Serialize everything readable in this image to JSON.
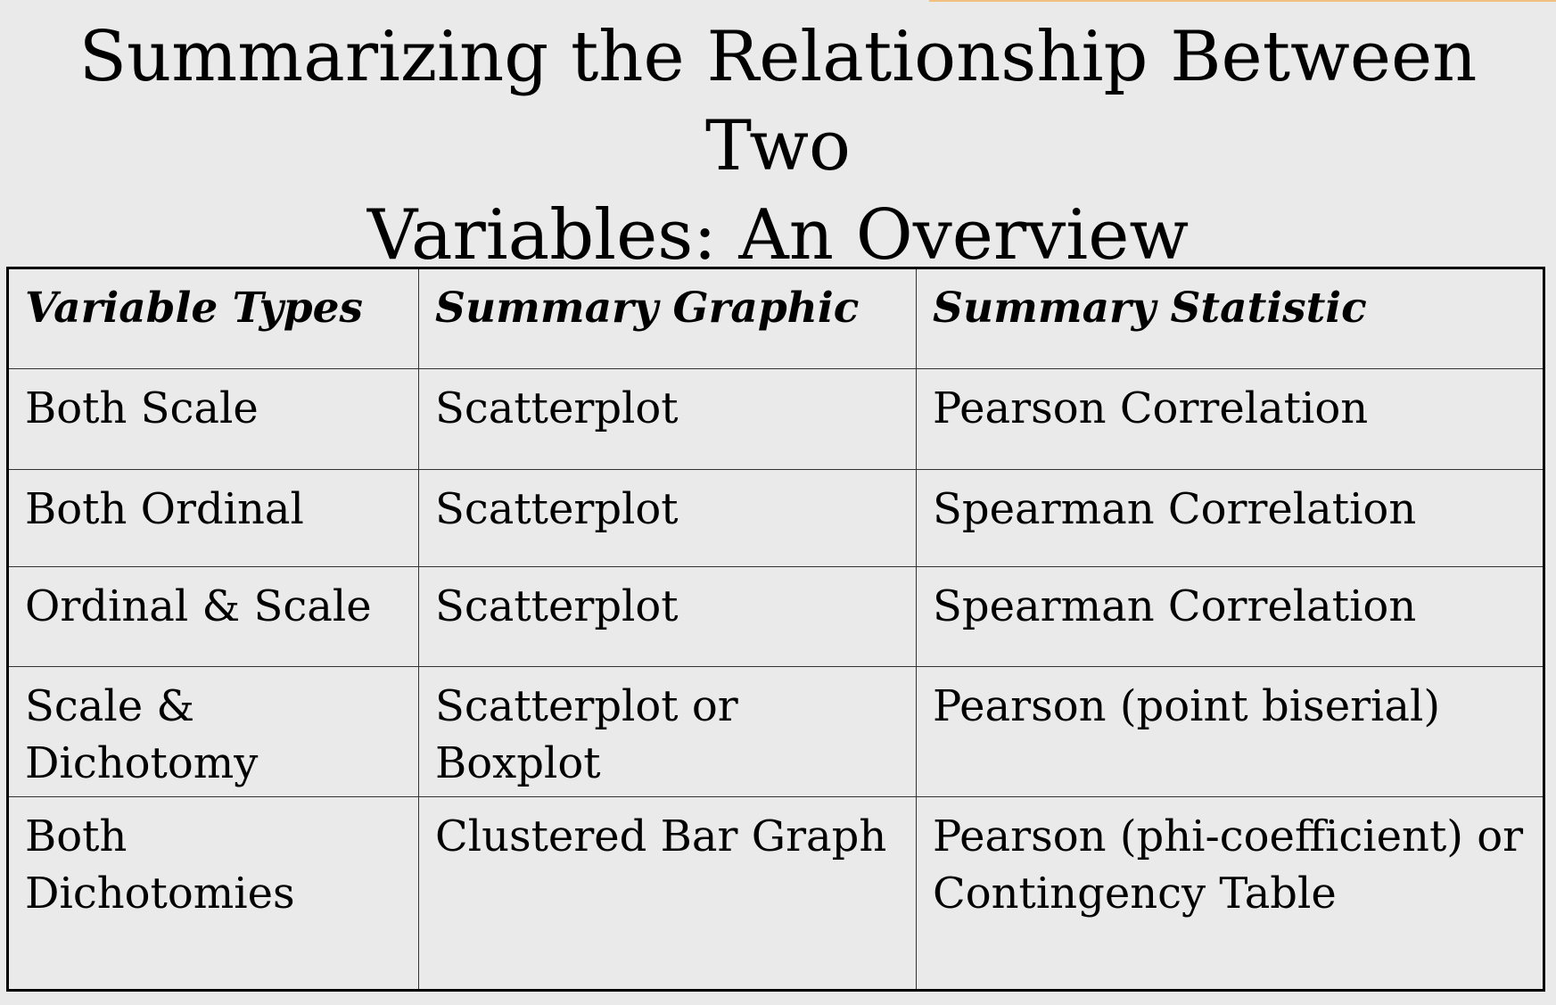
{
  "title": {
    "line1": "Summarizing the Relationship Between Two",
    "line2": "Variables: An Overview"
  },
  "table": {
    "headers": [
      "Variable Types",
      "Summary Graphic",
      "Summary Statistic"
    ],
    "rows": [
      [
        "Both Scale",
        "Scatterplot",
        "Pearson Correlation"
      ],
      [
        "Both Ordinal",
        "Scatterplot",
        "Spearman Correlation"
      ],
      [
        "Ordinal & Scale",
        "Scatterplot",
        "Spearman Correlation"
      ],
      [
        "Scale & Dichotomy",
        "Scatterplot or Boxplot",
        "Pearson (point biserial)"
      ],
      [
        "Both Dichotomies",
        "Clustered Bar Graph",
        "Pearson (phi-coefficient) or Contingency Table"
      ]
    ]
  }
}
